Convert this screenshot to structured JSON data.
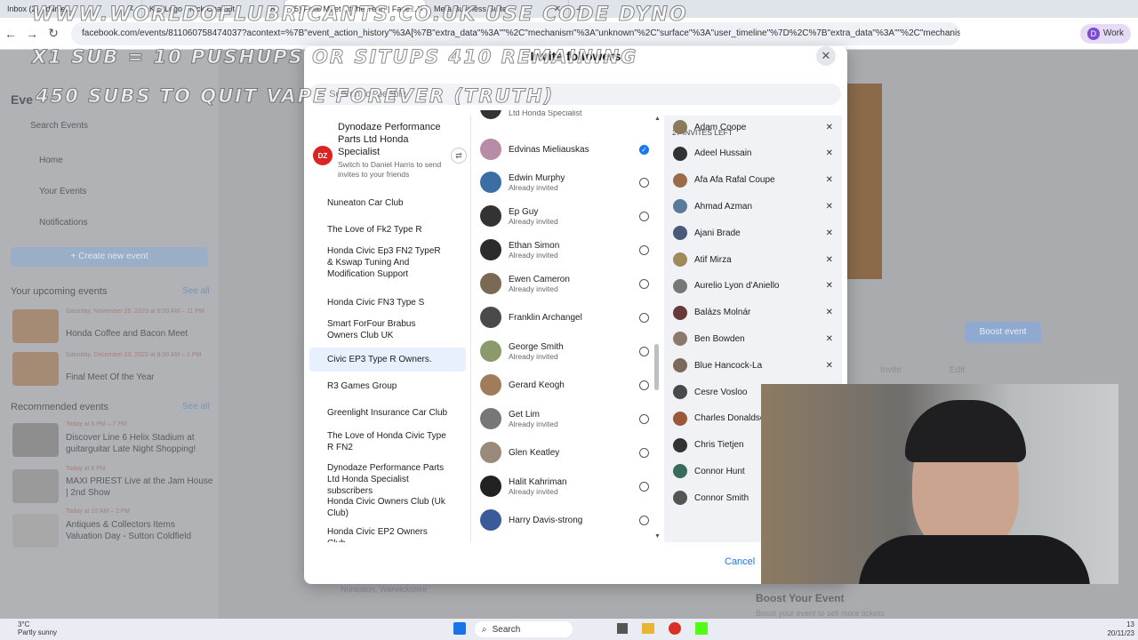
{
  "browser": {
    "tabs": [
      {
        "label": "Inbox (2) - daniel..."
      },
      {
        "label": "KickLogo - Kick Chatbot"
      },
      {
        "label": "(5) Final Meet Of the Year! | Face..."
      },
      {
        "label": "Meta Business Suite"
      }
    ],
    "url": "facebook.com/events/811060758474037?acontext=%7B\"event_action_history\"%3A[%7B\"extra_data\"%3A\"\"%2C\"mechanism\"%3A\"unknown\"%2C\"surface\"%3A\"user_timeline\"%7D%2C%7B\"extra_data\"%3A\"\"%2C\"mechanism\"...",
    "profile_label": "Work",
    "profile_initial": "D"
  },
  "overlay": {
    "line1": "WWW.WORLDOFLUBRICANTS.CO.UK USE CODE DYNO",
    "line2": "X1 SUB = 10 PUSHUPS OR SITUPS 410 REMAINING",
    "line3": "450 SUBS TO QUIT VAPE FOREVER (TRUTH)"
  },
  "background_page": {
    "section_title": "Eve",
    "search_placeholder": "Search Events",
    "nav": [
      "Home",
      "Your Events",
      "Notifications"
    ],
    "create_label": "+ Create new event",
    "upcoming_title": "Your upcoming events",
    "see_all": "See all",
    "upcoming": [
      {
        "date": "Saturday, November 25, 2023 at 8:00 AM – 11 PM",
        "title": "Honda Coffee and Bacon Meet"
      },
      {
        "date": "Saturday, December 23, 2023 at 8:00 AM – 1 PM",
        "title": "Final Meet Of the Year"
      }
    ],
    "recommended_title": "Recommended events",
    "recommended": [
      {
        "date": "Today at 5 PM – 7 PM",
        "title": "Discover Line 6 Helix Stadium at guitarguitar Late Night Shopping!"
      },
      {
        "date": "Today at 8 PM",
        "title": "MAXI PRIEST Live at the Jam House | 2nd Show"
      },
      {
        "date": "Today at 10 AM – 2 PM",
        "title": "Antiques & Collectors Items Valuation Day - Sutton Coldfield"
      }
    ],
    "boost_label": "Boost event",
    "invite_label": "Invite",
    "edit_label": "Edit",
    "boost_title": "Boost Your Event",
    "boost_sub": "Boost your event to sell more tickets",
    "location": "Nuneaton, Warwickshire"
  },
  "modal": {
    "title": "Invite followers",
    "search_placeholder": "Search for people",
    "page": {
      "name": "Dynodaze Performance Parts Ltd Honda Specialist",
      "sub": "Switch to Daniel Harris to send invites to your friends"
    },
    "groups": [
      "Nuneaton Car Club",
      "The Love of Fk2 Type R",
      "Honda Civic Ep3 FN2 TypeR & Kswap Tuning And Modification Support",
      "Honda Civic FN3 Type S",
      "Smart ForFour Brabus Owners Club UK",
      "Civic EP3 Type R Owners.",
      "R3 Games Group",
      "Greenlight Insurance Car Club",
      "The Love of Honda Civic Type R FN2",
      "Dynodaze Performance Parts Ltd Honda Specialist subscribers",
      "Honda Civic Owners Club (Uk Club)",
      "Honda Civic EP2 Owners Club"
    ],
    "top_cut_label": "Ltd Honda Specialist",
    "followers": [
      {
        "name": "Edvinas Mieliauskas",
        "status": "",
        "checked": true,
        "color": "#b88ba7"
      },
      {
        "name": "Edwin Murphy",
        "status": "Already invited",
        "checked": false,
        "color": "#3a6ea5"
      },
      {
        "name": "Ep Guy",
        "status": "Already invited",
        "checked": false,
        "color": "#333333"
      },
      {
        "name": "Ethan Simon",
        "status": "Already invited",
        "checked": false,
        "color": "#2c2c2c"
      },
      {
        "name": "Ewen Cameron",
        "status": "Already invited",
        "checked": false,
        "color": "#7a6a55"
      },
      {
        "name": "Franklin Archangel",
        "status": "",
        "checked": false,
        "color": "#4a4a4a"
      },
      {
        "name": "George Smith",
        "status": "Already invited",
        "checked": false,
        "color": "#8a9a6a"
      },
      {
        "name": "Gerard Keogh",
        "status": "",
        "checked": false,
        "color": "#a07c58"
      },
      {
        "name": "Get Lim",
        "status": "Already invited",
        "checked": false,
        "color": "#777777"
      },
      {
        "name": "Glen Keatley",
        "status": "",
        "checked": false,
        "color": "#9a8a7a"
      },
      {
        "name": "Halit Kahriman",
        "status": "Already invited",
        "checked": false,
        "color": "#222222"
      },
      {
        "name": "Harry Davis-strong",
        "status": "",
        "checked": false,
        "color": "#3a5a9a"
      }
    ],
    "invites_left": "27 INVITES LEFT",
    "invited": [
      {
        "name": "Adam Coope",
        "color": "#8a7a5a"
      },
      {
        "name": "Adeel Hussain",
        "color": "#333333"
      },
      {
        "name": "Afa Afa Rafal Coupe",
        "color": "#9a6a4a"
      },
      {
        "name": "Ahmad Azman",
        "color": "#5a7a9a"
      },
      {
        "name": "Ajani Brade",
        "color": "#4a5a7a"
      },
      {
        "name": "Atif Mirza",
        "color": "#a08a5a"
      },
      {
        "name": "Aurelio Lyon d'Aniello",
        "color": "#777777"
      },
      {
        "name": "Balázs Molnár",
        "color": "#6a3a3a"
      },
      {
        "name": "Ben Bowden",
        "color": "#8a7a6a"
      },
      {
        "name": "Blue Hancock-La",
        "color": "#7a6a5a"
      },
      {
        "name": "Cesre Vosloo",
        "color": "#4a4a4a"
      },
      {
        "name": "Charles Donaldso",
        "color": "#9a5a3a"
      },
      {
        "name": "Chris Tietjen",
        "color": "#333333"
      },
      {
        "name": "Connor Hunt",
        "color": "#3a6a5a"
      },
      {
        "name": "Connor Smith",
        "color": "#555555"
      }
    ],
    "cancel_label": "Cancel"
  },
  "taskbar": {
    "temp": "3°C",
    "weather": "Partly sunny",
    "search_label": "Search",
    "time": "13",
    "date": "20/11/23"
  },
  "colors": {
    "accent": "#1877f2",
    "selected_group_bg": "#e7f0fd",
    "invited_panel_bg": "#f0f2f5"
  }
}
